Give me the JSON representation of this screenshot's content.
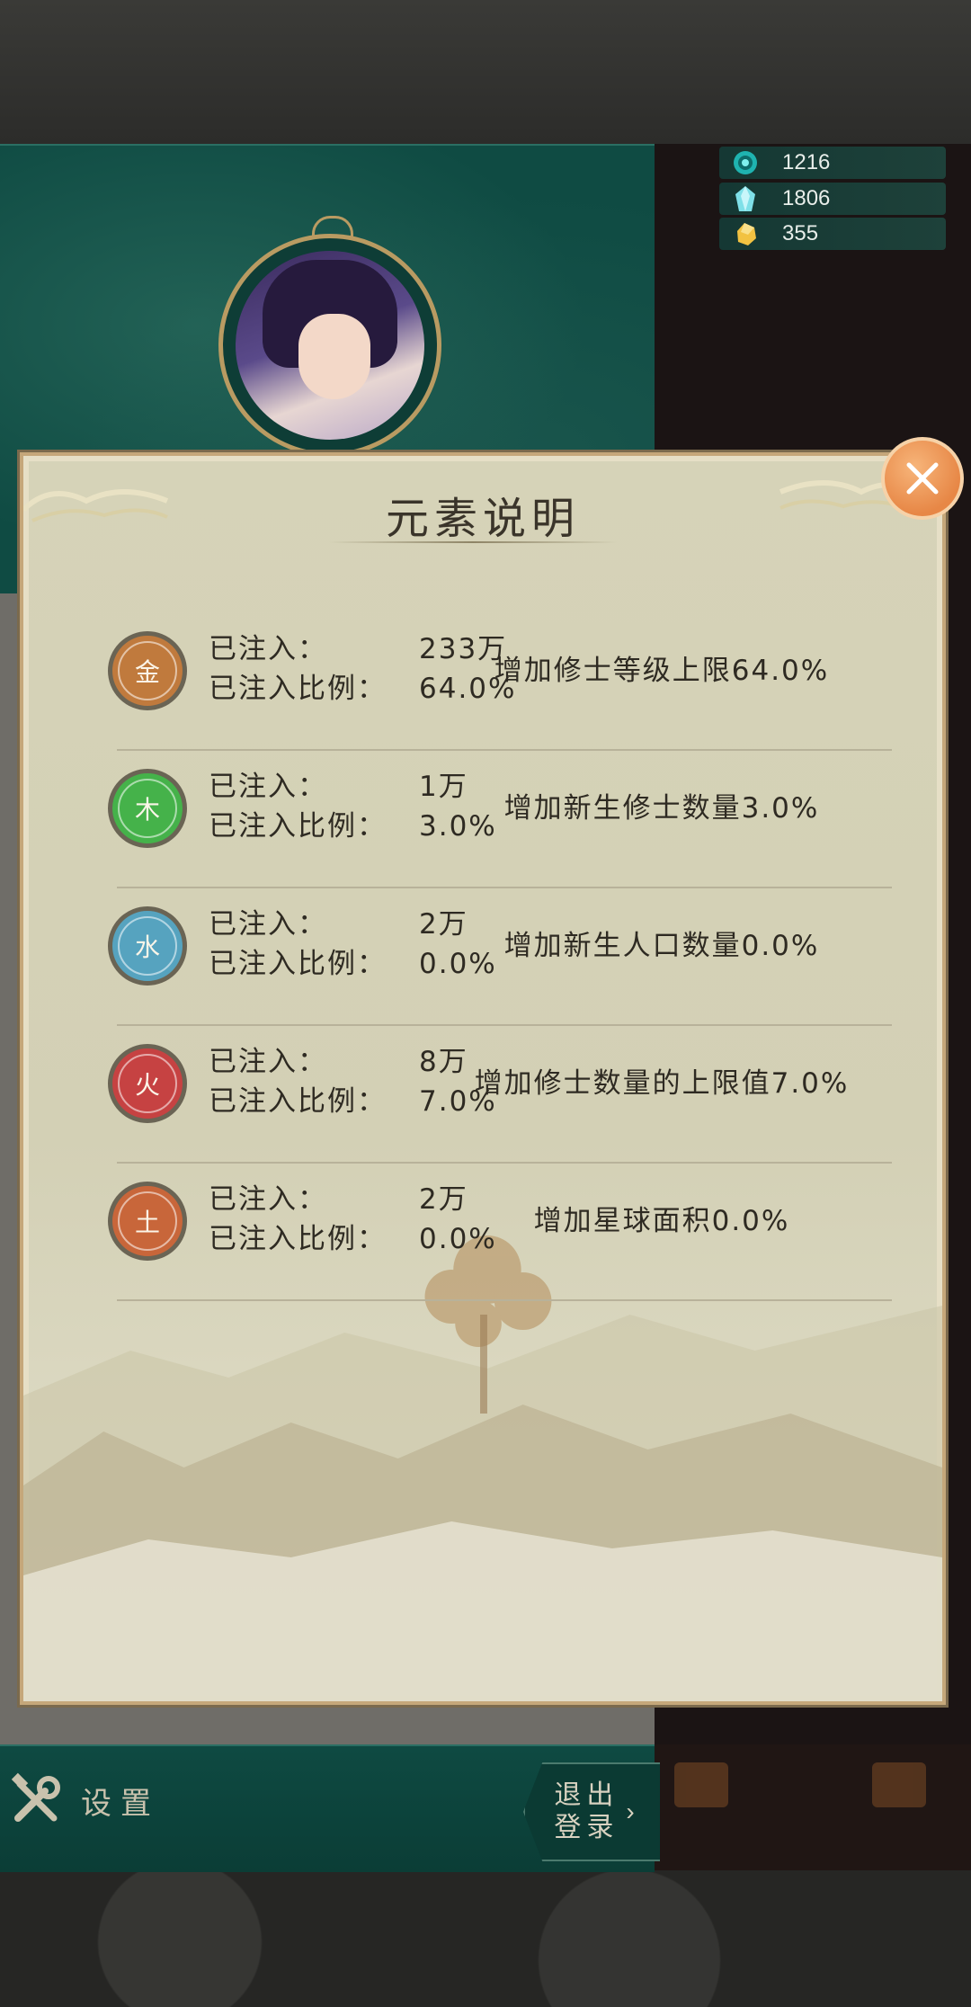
{
  "currencies": [
    {
      "icon": "spirit-orb-icon",
      "value": "1216"
    },
    {
      "icon": "crystal-icon",
      "value": "1806"
    },
    {
      "icon": "gold-ore-icon",
      "value": "355"
    }
  ],
  "dialog": {
    "title": "元素说明",
    "elements": [
      {
        "symbol": "金",
        "color": "#c07a3d",
        "injected_label": "已注入：",
        "injected_value": "233万",
        "ratio_label": "已注入比例：",
        "ratio_value": "64.0%",
        "effect": "增加修士等级上限64.0%"
      },
      {
        "symbol": "木",
        "color": "#45b24a",
        "injected_label": "已注入：",
        "injected_value": "1万",
        "ratio_label": "已注入比例：",
        "ratio_value": "3.0%",
        "effect": "增加新生修士数量3.0%"
      },
      {
        "symbol": "水",
        "color": "#56a3bf",
        "injected_label": "已注入：",
        "injected_value": "2万",
        "ratio_label": "已注入比例：",
        "ratio_value": "0.0%",
        "effect": "增加新生人口数量0.0%"
      },
      {
        "symbol": "火",
        "color": "#c64242",
        "injected_label": "已注入：",
        "injected_value": "8万",
        "ratio_label": "已注入比例：",
        "ratio_value": "7.0%",
        "effect": "增加修士数量的上限值7.0%"
      },
      {
        "symbol": "土",
        "color": "#c8663a",
        "injected_label": "已注入：",
        "injected_value": "2万",
        "ratio_label": "已注入比例：",
        "ratio_value": "0.0%",
        "effect": "增加星球面积0.0%"
      }
    ]
  },
  "bottom": {
    "settings_label": "设置",
    "logout_label": "退出登录"
  }
}
